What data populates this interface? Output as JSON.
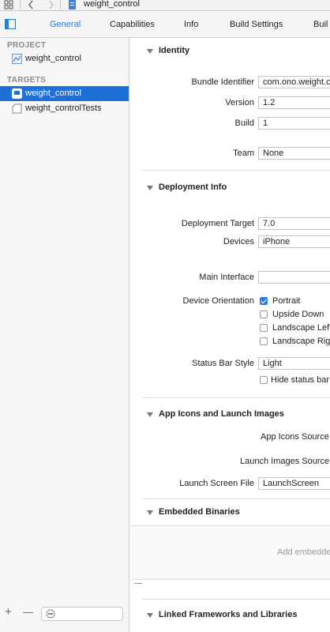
{
  "jumpbar": {
    "breadcrumb": "weight_control"
  },
  "tabs": [
    {
      "label": "General",
      "active": true
    },
    {
      "label": "Capabilities"
    },
    {
      "label": "Info"
    },
    {
      "label": "Build Settings"
    },
    {
      "label": "Buil"
    }
  ],
  "sidebar": {
    "project_header": "PROJECT",
    "project_item": "weight_control",
    "targets_header": "TARGETS",
    "targets": [
      {
        "label": "weight_control",
        "selected": true
      },
      {
        "label": "weight_controlTests"
      }
    ],
    "add_symbol": "+",
    "remove_symbol": "—"
  },
  "identity": {
    "title": "Identity",
    "bundle_identifier_label": "Bundle Identifier",
    "bundle_identifier_value": "com.ono.weight.c",
    "version_label": "Version",
    "version_value": "1.2",
    "build_label": "Build",
    "build_value": "1",
    "team_label": "Team",
    "team_value": "None"
  },
  "deployment": {
    "title": "Deployment Info",
    "target_label": "Deployment Target",
    "target_value": "7.0",
    "devices_label": "Devices",
    "devices_value": "iPhone",
    "main_interface_label": "Main Interface",
    "main_interface_value": "",
    "orientation_label": "Device Orientation",
    "orientations": [
      {
        "label": "Portrait",
        "checked": true
      },
      {
        "label": "Upside Down",
        "checked": false
      },
      {
        "label": "Landscape Lef",
        "checked": false
      },
      {
        "label": "Landscape Rig",
        "checked": false
      }
    ],
    "status_bar_label": "Status Bar Style",
    "status_bar_value": "Light",
    "hide_status_bar": "Hide status bar"
  },
  "app_icons": {
    "title": "App Icons and Launch Images",
    "icons_source_label": "App Icons Source",
    "launch_images_label": "Launch Images Source",
    "launch_screen_label": "Launch Screen File",
    "launch_screen_value": "LaunchScreen"
  },
  "embedded": {
    "title": "Embedded Binaries",
    "placeholder": "Add embedde"
  },
  "linked": {
    "title": "Linked Frameworks and Libraries"
  }
}
